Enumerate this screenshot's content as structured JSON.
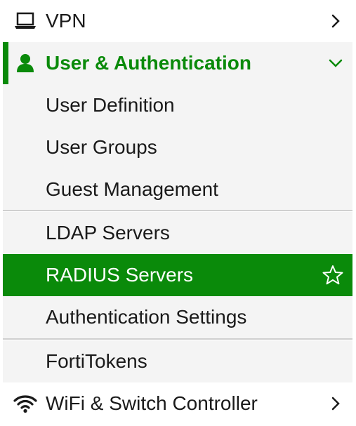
{
  "nav": {
    "vpn": {
      "label": "VPN",
      "icon": "laptop-icon",
      "expand_icon": "chevron-right-icon"
    },
    "user_auth": {
      "label": "User & Authentication",
      "icon": "user-icon",
      "expand_icon": "chevron-down-icon",
      "expanded": true,
      "items": [
        {
          "label": "User Definition"
        },
        {
          "label": "User Groups"
        },
        {
          "label": "Guest Management"
        },
        {
          "label": "LDAP Servers"
        },
        {
          "label": "RADIUS Servers",
          "active": true,
          "icon": "star-icon"
        },
        {
          "label": "Authentication Settings"
        },
        {
          "label": "FortiTokens"
        }
      ]
    },
    "wifi": {
      "label": "WiFi & Switch Controller",
      "icon": "wifi-icon",
      "expand_icon": "chevron-right-icon"
    }
  },
  "colors": {
    "accent": "#0a8a0a",
    "submenu_bg": "#f4f4f4",
    "divider": "#cfcfcf",
    "text": "#1a1a1a"
  }
}
